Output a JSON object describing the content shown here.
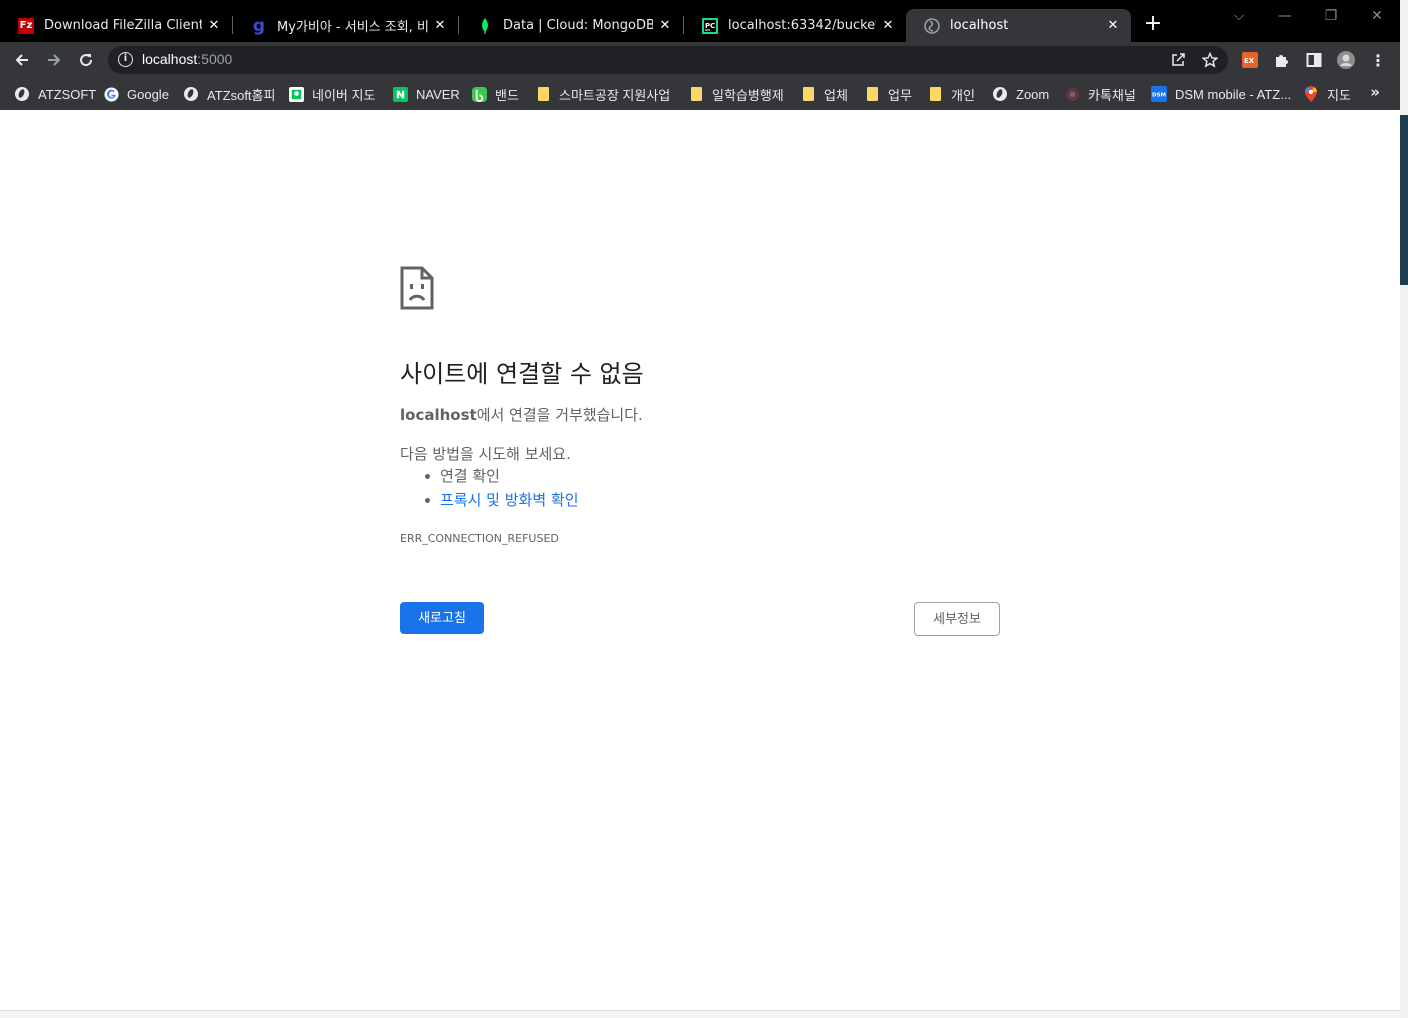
{
  "browser": {
    "tabs": [
      {
        "title": "Download FileZilla Client for ",
        "favicon": "filezilla-icon",
        "favicon_color": "#bf0000",
        "active": false
      },
      {
        "title": "My가비아 - 서비스 조회, 비용",
        "favicon": "gabia-icon",
        "favicon_color": "#3b4cca",
        "active": false
      },
      {
        "title": "Data | Cloud: MongoDB Clou",
        "favicon": "mongodb-leaf-icon",
        "favicon_color": "#00ed64",
        "active": false
      },
      {
        "title": "localhost:63342/bucket/app.p",
        "favicon": "pycharm-icon",
        "favicon_color": "#21d789",
        "active": false
      },
      {
        "title": "localhost",
        "favicon": "globe-icon",
        "favicon_color": "#9aa0a6",
        "active": true
      }
    ],
    "new_tab_label": "+",
    "address": {
      "host": "localhost",
      "port": ":5000"
    },
    "bookmarks": [
      {
        "label": "ATZSOFT",
        "icon": "globe-icon"
      },
      {
        "label": "Google",
        "icon": "google-icon"
      },
      {
        "label": "ATZsoft홈피",
        "icon": "globe-icon"
      },
      {
        "label": "네이버 지도",
        "icon": "naver-map-icon"
      },
      {
        "label": "NAVER",
        "icon": "naver-icon"
      },
      {
        "label": "밴드",
        "icon": "band-icon"
      },
      {
        "label": "스마트공장 지원사업",
        "icon": "folder-icon"
      },
      {
        "label": "일학습병행제",
        "icon": "folder-icon"
      },
      {
        "label": "업체",
        "icon": "folder-icon"
      },
      {
        "label": "업무",
        "icon": "folder-icon"
      },
      {
        "label": "개인",
        "icon": "folder-icon"
      },
      {
        "label": "Zoom",
        "icon": "globe-icon"
      },
      {
        "label": "카톡채널",
        "icon": "kakao-icon"
      },
      {
        "label": "DSM mobile - ATZ...",
        "icon": "dsm-icon"
      },
      {
        "label": "지도",
        "icon": "google-maps-icon"
      }
    ],
    "bookmarks_more": "»"
  },
  "error_page": {
    "title": "사이트에 연결할 수 없음",
    "host": "localhost",
    "description_suffix": "에서 연결을 거부했습니다.",
    "try_label": "다음 방법을 시도해 보세요.",
    "suggestions": [
      "연결 확인",
      "프록시 및 방화벽 확인"
    ],
    "error_code": "ERR_CONNECTION_REFUSED",
    "reload_label": "새로고침",
    "details_label": "세부정보"
  },
  "colors": {
    "tab_strip": "#000000",
    "toolbar": "#35363a",
    "omnibox": "#202124",
    "primary_button": "#1a73e8",
    "link": "#1a73e8",
    "folder": "#fdd663"
  }
}
